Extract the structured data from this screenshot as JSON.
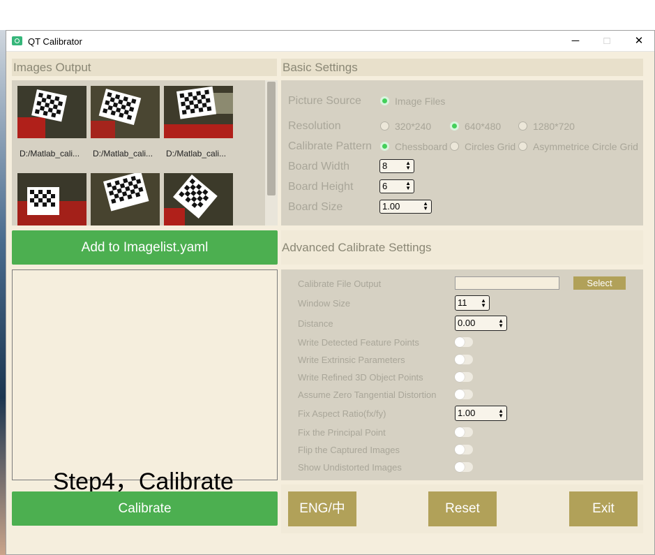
{
  "window": {
    "title": "QT Calibrator",
    "minimize": "─",
    "maximize": "□",
    "close": "✕"
  },
  "images_output": {
    "heading": "Images Output",
    "thumbnails": [
      {
        "label": "D:/Matlab_cali..."
      },
      {
        "label": "D:/Matlab_cali..."
      },
      {
        "label": "D:/Matlab_cali..."
      }
    ],
    "add_button": "Add to Imagelist.yaml"
  },
  "basic_settings": {
    "heading": "Basic Settings",
    "picture_source": {
      "label": "Picture Source",
      "option": "Image Files"
    },
    "resolution": {
      "label": "Resolution",
      "options": [
        "320*240",
        "640*480",
        "1280*720"
      ],
      "selected": "640*480"
    },
    "calibrate_pattern": {
      "label": "Calibrate Pattern",
      "options": [
        "Chessboard",
        "Circles Grid",
        "Asymmetrice Circle Grid"
      ],
      "selected": "Chessboard"
    },
    "board_width": {
      "label": "Board Width",
      "value": "8"
    },
    "board_height": {
      "label": "Board Height",
      "value": "6"
    },
    "board_size": {
      "label": "Board Size",
      "value": "1.00"
    }
  },
  "advanced_settings": {
    "heading": "Advanced Calibrate Settings",
    "file_output": {
      "label": "Calibrate File Output",
      "value": "",
      "button": "Select"
    },
    "window_size": {
      "label": "Window Size",
      "value": "11"
    },
    "distance": {
      "label": "Distance",
      "value": "0.00"
    },
    "write_detected": {
      "label": "Write Detected Feature Points"
    },
    "write_extrinsic": {
      "label": "Write Extrinsic Parameters"
    },
    "write_refined": {
      "label": "Write Refined 3D Object Points"
    },
    "zero_tangential": {
      "label": "Assume Zero Tangential Distortion"
    },
    "aspect_ratio": {
      "label": "Fix Aspect Ratio(fx/fy)",
      "value": "1.00"
    },
    "principal_point": {
      "label": "Fix the Principal Point"
    },
    "flip_images": {
      "label": "Flip the Captured Images"
    },
    "undistorted": {
      "label": "Show Undistorted Images"
    }
  },
  "overlay_caption": "Step4，Calibrate",
  "calibrate_button": "Calibrate",
  "bottom_buttons": {
    "language": "ENG/中",
    "reset": "Reset",
    "exit": "Exit"
  },
  "colors": {
    "green": "#4caf50",
    "gold": "#b1a159",
    "panel": "#d6d1c3",
    "background": "#f5eedd"
  }
}
